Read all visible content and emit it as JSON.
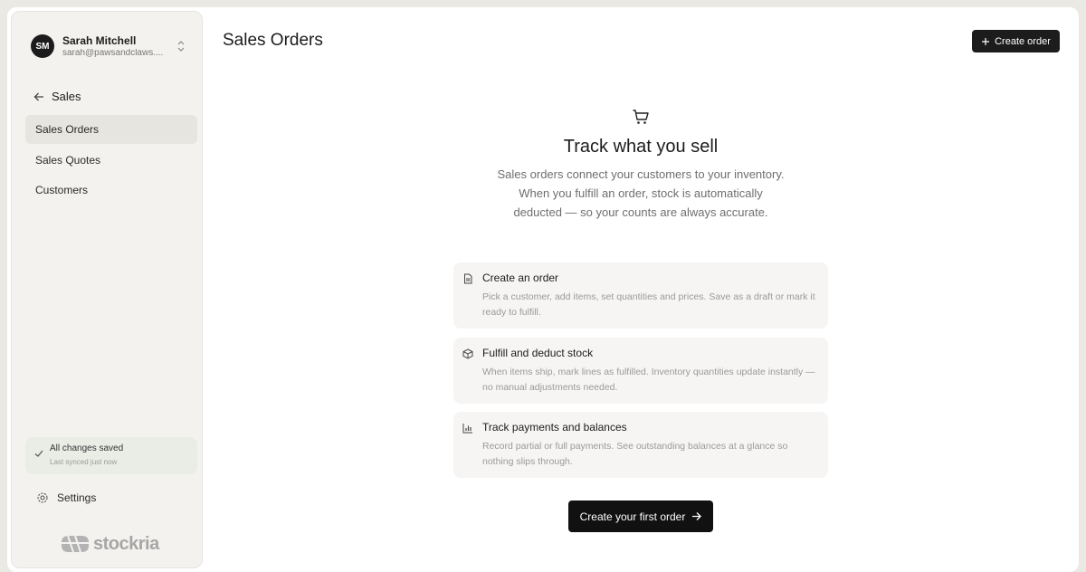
{
  "sidebar": {
    "user": {
      "initials": "SM",
      "name": "Sarah Mitchell",
      "email": "sarah@pawsandclaws...."
    },
    "back_label": "Sales",
    "items": [
      {
        "label": "Sales Orders",
        "active": true
      },
      {
        "label": "Sales Quotes",
        "active": false
      },
      {
        "label": "Customers",
        "active": false
      }
    ],
    "status": {
      "title": "All changes saved",
      "subtitle": "Last synced just now"
    },
    "settings_label": "Settings",
    "logo_text": "stockria"
  },
  "header": {
    "title": "Sales Orders",
    "create_button": "Create order"
  },
  "empty_state": {
    "icon": "shopping-cart-icon",
    "title": "Track what you sell",
    "description": "Sales orders connect your customers to your inventory. When you fulfill an order, stock is automatically deducted — so your counts are always accurate.",
    "cards": [
      {
        "icon": "document-icon",
        "title": "Create an order",
        "description": "Pick a customer, add items, set quantities and prices. Save as a draft or mark it ready to fulfill."
      },
      {
        "icon": "package-icon",
        "title": "Fulfill and deduct stock",
        "description": "When items ship, mark lines as fulfilled. Inventory quantities update instantly — no manual adjustments needed."
      },
      {
        "icon": "bar-chart-icon",
        "title": "Track payments and balances",
        "description": "Record partial or full payments. See outstanding balances at a glance so nothing slips through."
      }
    ],
    "cta_label": "Create your first order"
  },
  "colors": {
    "accent": "#1c1c1c",
    "sidebar_bg": "#f3f2ef",
    "saved_bg": "#e9ede6"
  }
}
